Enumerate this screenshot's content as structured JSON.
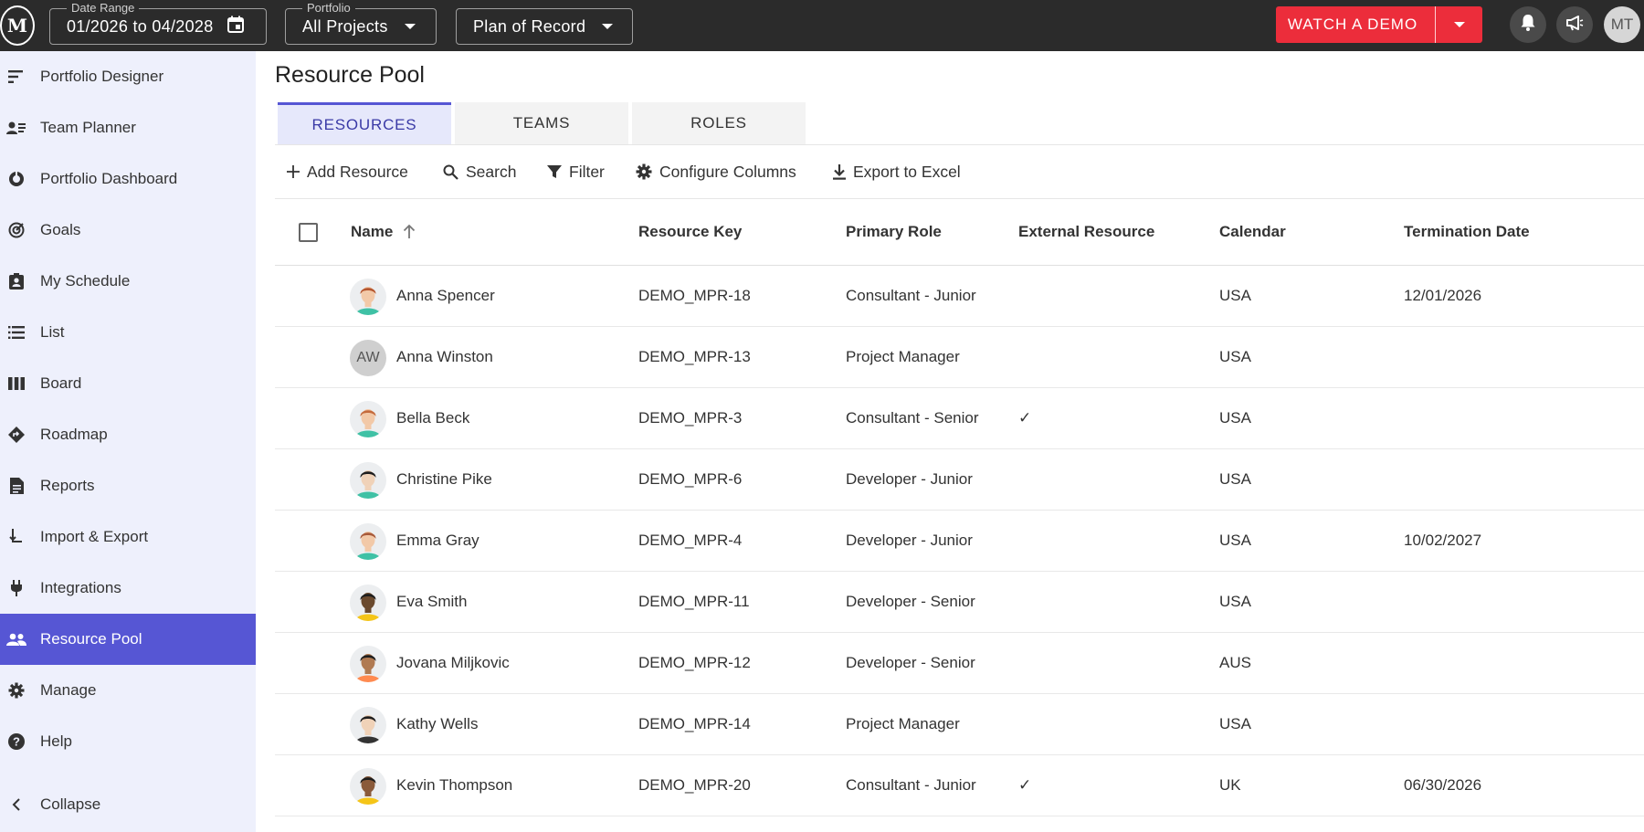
{
  "topbar": {
    "logo_text": "M",
    "date_range": {
      "legend": "Date Range",
      "value": "01/2026 to 04/2028"
    },
    "portfolio": {
      "legend": "Portfolio",
      "value": "All Projects"
    },
    "plan": {
      "value": "Plan of Record"
    },
    "watch_demo": "WATCH A DEMO",
    "user_initials": "MT",
    "icons": [
      "bell-icon",
      "megaphone-icon"
    ]
  },
  "sidebar": {
    "items": [
      {
        "label": "Portfolio Designer",
        "icon": "designer-icon"
      },
      {
        "label": "Team Planner",
        "icon": "team-planner-icon"
      },
      {
        "label": "Portfolio Dashboard",
        "icon": "dashboard-icon"
      },
      {
        "label": "Goals",
        "icon": "goals-icon"
      },
      {
        "label": "My Schedule",
        "icon": "schedule-icon"
      },
      {
        "label": "List",
        "icon": "list-icon"
      },
      {
        "label": "Board",
        "icon": "board-icon"
      },
      {
        "label": "Roadmap",
        "icon": "roadmap-icon"
      },
      {
        "label": "Reports",
        "icon": "reports-icon"
      },
      {
        "label": "Import & Export",
        "icon": "import-export-icon"
      },
      {
        "label": "Integrations",
        "icon": "plug-icon"
      },
      {
        "label": "Resource Pool",
        "icon": "people-icon",
        "active": true
      },
      {
        "label": "Manage",
        "icon": "gear-icon"
      },
      {
        "label": "Help",
        "icon": "help-icon"
      },
      {
        "label": "Collapse",
        "icon": "chevron-left-icon"
      }
    ]
  },
  "main": {
    "title": "Resource Pool",
    "tabs": [
      {
        "label": "RESOURCES",
        "active": true
      },
      {
        "label": "TEAMS"
      },
      {
        "label": "ROLES"
      }
    ],
    "toolbar": {
      "add": "Add Resource",
      "search": "Search",
      "filter": "Filter",
      "configure": "Configure Columns",
      "export": "Export to Excel"
    },
    "columns": {
      "name": "Name",
      "key": "Resource Key",
      "role": "Primary Role",
      "external": "External Resource",
      "calendar": "Calendar",
      "termination": "Termination Date"
    },
    "rows": [
      {
        "name": "Anna Spencer",
        "key": "DEMO_MPR-18",
        "role": "Consultant - Junior",
        "external": "",
        "calendar": "USA",
        "termination": "12/01/2026",
        "avatar": "illustration"
      },
      {
        "name": "Anna Winston",
        "key": "DEMO_MPR-13",
        "role": "Project Manager",
        "external": "",
        "calendar": "USA",
        "termination": "",
        "avatar": "initials",
        "initials": "AW"
      },
      {
        "name": "Bella Beck",
        "key": "DEMO_MPR-3",
        "role": "Consultant - Senior",
        "external": "✓",
        "calendar": "USA",
        "termination": "",
        "avatar": "illustration"
      },
      {
        "name": "Christine Pike",
        "key": "DEMO_MPR-6",
        "role": "Developer - Junior",
        "external": "",
        "calendar": "USA",
        "termination": "",
        "avatar": "illustration"
      },
      {
        "name": "Emma Gray",
        "key": "DEMO_MPR-4",
        "role": "Developer - Junior",
        "external": "",
        "calendar": "USA",
        "termination": "10/02/2027",
        "avatar": "illustration"
      },
      {
        "name": "Eva Smith",
        "key": "DEMO_MPR-11",
        "role": "Developer - Senior",
        "external": "",
        "calendar": "USA",
        "termination": "",
        "avatar": "illustration"
      },
      {
        "name": "Jovana Miljkovic",
        "key": "DEMO_MPR-12",
        "role": "Developer - Senior",
        "external": "",
        "calendar": "AUS",
        "termination": "",
        "avatar": "illustration"
      },
      {
        "name": "Kathy Wells",
        "key": "DEMO_MPR-14",
        "role": "Project Manager",
        "external": "",
        "calendar": "USA",
        "termination": "",
        "avatar": "illustration"
      },
      {
        "name": "Kevin Thompson",
        "key": "DEMO_MPR-20",
        "role": "Consultant - Junior",
        "external": "✓",
        "calendar": "UK",
        "termination": "06/30/2026",
        "avatar": "illustration"
      }
    ]
  },
  "colors": {
    "topbar_bg": "#2b2b2b",
    "sidebar_bg": "#eef0fc",
    "accent": "#5656d4",
    "demo_red": "#ec2d3b"
  }
}
